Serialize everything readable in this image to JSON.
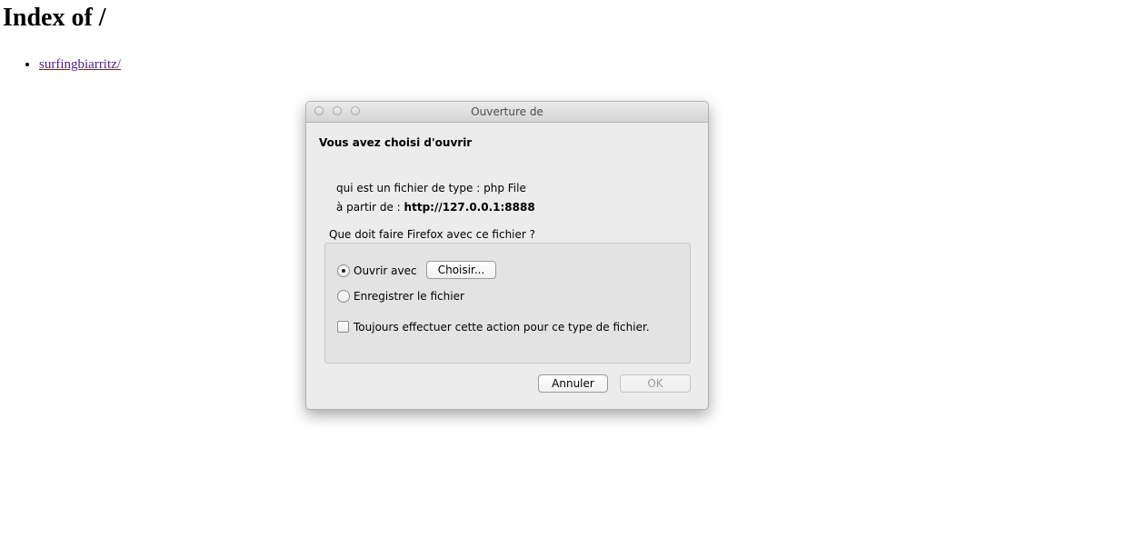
{
  "page": {
    "title": "Index of /",
    "entries": [
      {
        "label": "surfingbiarritz/"
      }
    ]
  },
  "dialog": {
    "window_title": "Ouverture de",
    "heading": "Vous avez choisi d'ouvrir",
    "type_label": "qui est un fichier de type :",
    "type_value": "php File",
    "source_label": "à partir de :",
    "source_value": "http://127.0.0.1:8888",
    "question": "Que doit faire Firefox avec ce fichier ?",
    "options": {
      "open_with": {
        "label": "Ouvrir avec",
        "selected": true
      },
      "save_file": {
        "label": "Enregistrer le fichier",
        "selected": false
      }
    },
    "choose_button": "Choisir...",
    "always_label": "Toujours effectuer cette action pour ce type de fichier.",
    "always_checked": false,
    "cancel_button": "Annuler",
    "ok_button": "OK",
    "ok_enabled": false
  }
}
